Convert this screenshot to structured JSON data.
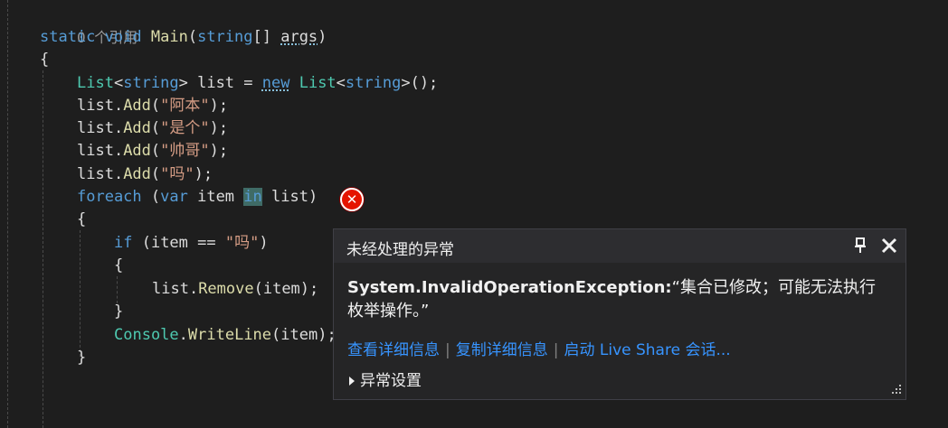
{
  "code": {
    "references": "0 个引用",
    "l1_static": "static",
    "l1_void": "void",
    "l1_main": "Main",
    "l1_paren_open": "(",
    "l1_string": "string",
    "l1_brackets": "[] ",
    "l1_args": "args",
    "l1_paren_close": ")",
    "open_brace": "{",
    "close_brace": "}",
    "l3_list_type": "List",
    "l3_lt": "<",
    "l3_string": "string",
    "l3_gt": "> list = ",
    "l3_new": "new",
    "l3_space": " ",
    "l3_list_ctor": "List",
    "l3_lt2": "<",
    "l3_string2": "string",
    "l3_end": ">();",
    "add_prefix": "list.",
    "add_method": "Add",
    "add_open": "(",
    "add_close": ");",
    "add_values": [
      "\"阿本\"",
      "\"是个\"",
      "\"帅哥\"",
      "\"吗\""
    ],
    "foreach_kw": "foreach",
    "foreach_open": " (",
    "foreach_var": "var",
    "foreach_item": " item ",
    "foreach_in": "in",
    "foreach_tail": " list)",
    "if_kw": "if",
    "if_cond_start": " (item == ",
    "if_string": "\"吗\"",
    "if_cond_end": ")",
    "remove_prefix": "list.",
    "remove_method": "Remove",
    "remove_args": "(item);",
    "console_type": "Console",
    "console_dot": ".",
    "console_method": "WriteLine",
    "console_args": "(item);"
  },
  "popup": {
    "title": "未经处理的异常",
    "exception_type": "System.InvalidOperationException:",
    "exception_message": "“集合已修改；可能无法执行枚举操作。”",
    "links": [
      "查看详细信息",
      "复制详细信息",
      "启动 Live Share 会话..."
    ],
    "settings": "异常设置"
  },
  "colors": {
    "background": "#1e1e1e",
    "keyword": "#569cd6",
    "type": "#4ec9b0",
    "method": "#dcdcaa",
    "string": "#d69d85",
    "link": "#3794ff",
    "error": "#e51400"
  }
}
